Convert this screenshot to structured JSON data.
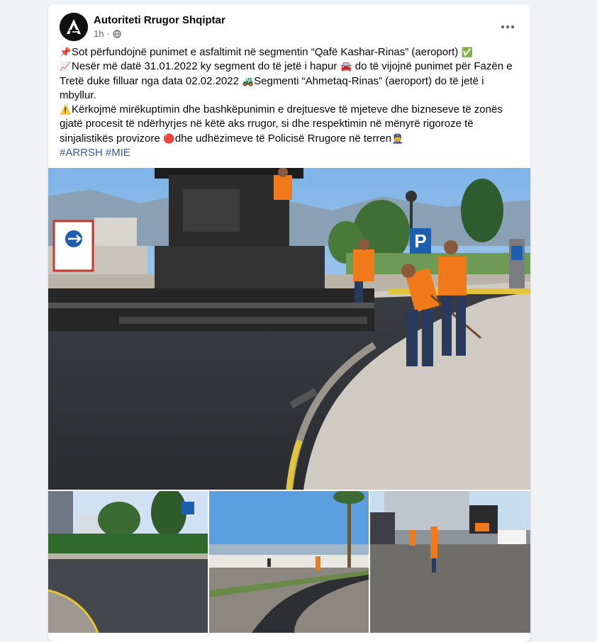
{
  "post": {
    "page_name": "Autoriteti Rrugor Shqiptar",
    "time": "1h",
    "privacy_icon": "globe-icon",
    "more_icon": "more-horizontal-icon"
  },
  "content": {
    "p1": {
      "emoji1": "📌",
      "text1": "Sot përfundojnë punimet e asfaltimit në segmentin “Qafë Kashar-Rinas” (aeroport) ",
      "emoji2": "✅"
    },
    "p2": {
      "emoji1": "📈",
      "text1": "Nesër më datë 31.01.2022 ky segment do të jetë i hapur ",
      "emoji2": "🚘",
      "text2": " do të vijojnë punimet për Fazën e Tretë duke filluar nga data 02.02.2022 ",
      "emoji3": "🚜",
      "text3": "Segmenti “Ahmetaq-Rinas” (aeroport) do të jetë i mbyllur."
    },
    "p3": {
      "emoji1": "⚠️",
      "text1": "Kërkojmë mirëkuptimin dhe bashkëpunimin e drejtuesve të mjeteve dhe bizneseve të zonës gjatë procesit të ndërhyrjes në këtë aks rrugor, si dhe respektimin në mënyrë rigoroze të sinjalistikës provizore ",
      "emoji2": "🔴",
      "text2": "dhe udhëzimeve të Policisë Rrugore në terren",
      "emoji3": "👮"
    },
    "hashtags": [
      "#ARRSH",
      "#MIE"
    ]
  },
  "photos": {
    "hero_alt": "road paving machine and workers",
    "thumb_alts": [
      "roundabout road",
      "new asphalt road",
      "paving site"
    ],
    "sign_letter": "P"
  },
  "colors": {
    "link": "#385898",
    "secondary_text": "#65676b",
    "safety_orange": "#f07a1a"
  }
}
